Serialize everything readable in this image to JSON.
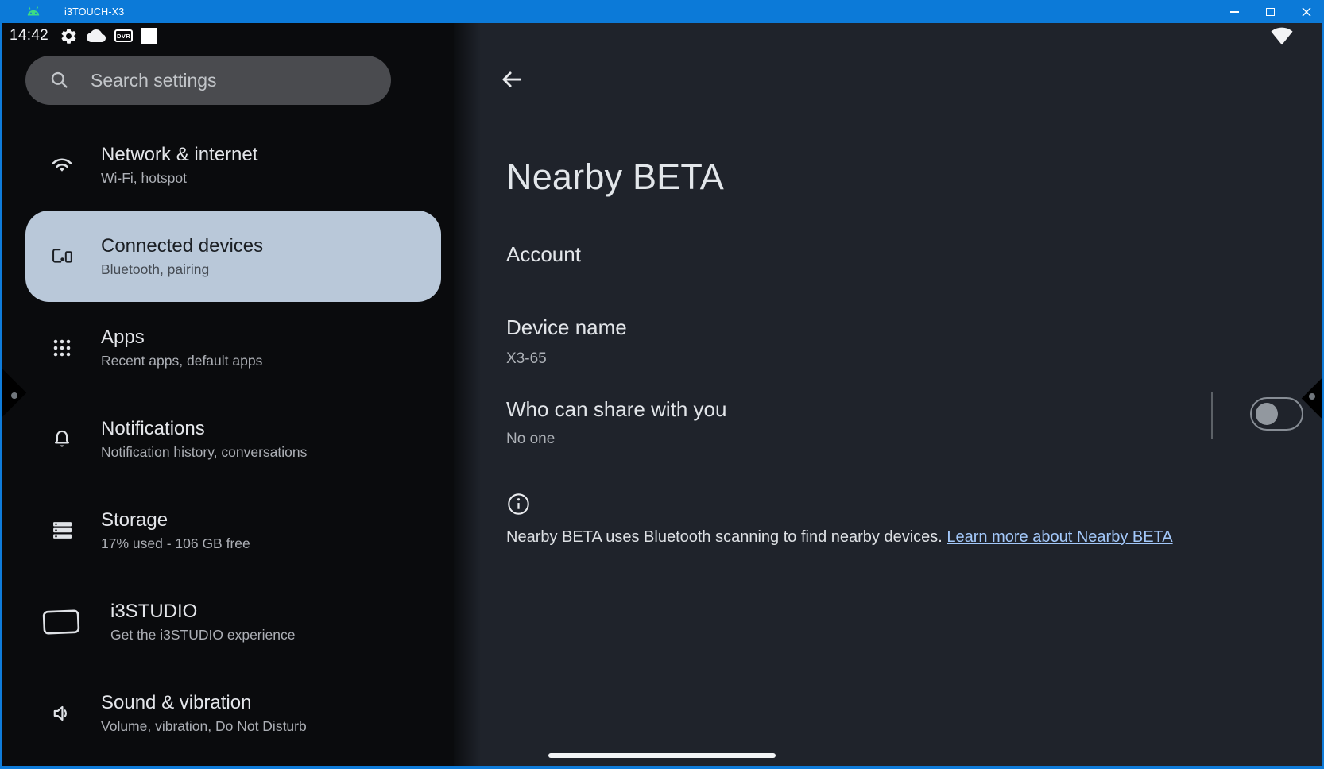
{
  "window": {
    "title": "i3TOUCH-X3",
    "controls": {
      "minimize": "minimize",
      "maximize": "maximize",
      "close": "close"
    }
  },
  "status_bar": {
    "time": "14:42",
    "dvr_label": "DVR",
    "icons": [
      "settings-gear-icon",
      "cloud-icon",
      "dvr-icon",
      "white-square-icon",
      "wifi-icon"
    ]
  },
  "sidebar": {
    "search_placeholder": "Search settings",
    "items": [
      {
        "label": "Network & internet",
        "sublabel": "Wi-Fi, hotspot",
        "icon": "wifi-icon",
        "selected": false
      },
      {
        "label": "Connected devices",
        "sublabel": "Bluetooth, pairing",
        "icon": "devices-icon",
        "selected": true
      },
      {
        "label": "Apps",
        "sublabel": "Recent apps, default apps",
        "icon": "apps-grid-icon",
        "selected": false
      },
      {
        "label": "Notifications",
        "sublabel": "Notification history, conversations",
        "icon": "bell-icon",
        "selected": false
      },
      {
        "label": "Storage",
        "sublabel": "17% used - 106 GB free",
        "icon": "storage-icon",
        "selected": false
      },
      {
        "label": "i3STUDIO",
        "sublabel": "Get the i3STUDIO experience",
        "icon": "display-icon",
        "selected": false
      },
      {
        "label": "Sound & vibration",
        "sublabel": "Volume, vibration, Do Not Disturb",
        "icon": "speaker-icon",
        "selected": false
      }
    ]
  },
  "main": {
    "title": "Nearby BETA",
    "section_account": "Account",
    "device_name": {
      "label": "Device name",
      "value": "X3-65"
    },
    "share": {
      "label": "Who can share with you",
      "value": "No one",
      "toggle_on": false
    },
    "info_text": "Nearby BETA uses Bluetooth scanning to find nearby devices. ",
    "info_link": "Learn more about Nearby BETA"
  },
  "colors": {
    "titlebar_blue": "#0c7ad8",
    "window_border_blue": "#0f7cda",
    "sidebar_bg": "#0a0b0d",
    "panel_bg": "#1f232b",
    "selected_item_bg": "#b9c8d9",
    "link_blue": "#a3c8fa",
    "search_pill_bg": "#4a4b4f"
  }
}
